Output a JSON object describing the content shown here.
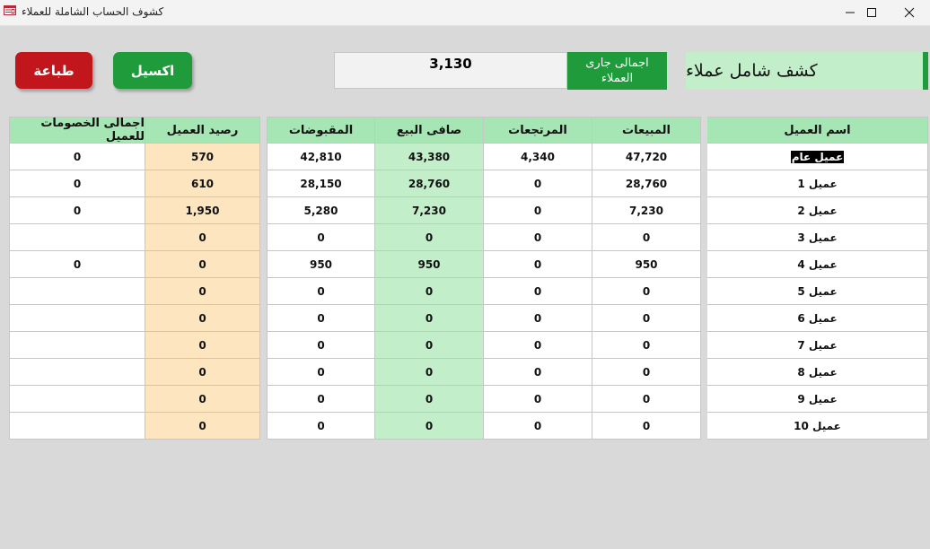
{
  "window": {
    "title": "كشوف الحساب الشاملة للعملاء",
    "app_icon": "form-icon",
    "controls": [
      "minimize-icon",
      "maximize-icon",
      "close-icon"
    ]
  },
  "header": {
    "report_title": "كشف شامل عملاء",
    "total_label": "اجمالى جارى\nالعملاء",
    "total_value": "3,130",
    "excel_button": "اكسيل",
    "print_button": "طباعة"
  },
  "colors": {
    "accent_green": "#1f9b3c",
    "header_green": "#a6e6b5",
    "light_green": "#c2efca",
    "balance_peach": "#fde5c0",
    "print_red": "#c0161c"
  },
  "customers_table": {
    "columns": [
      "اسم العميل",
      "المبيعات",
      "المرتجعات",
      "صافى البيع",
      "المقبوضات"
    ],
    "rows": [
      [
        "عميل عام",
        "47,720",
        "4,340",
        "43,380",
        "42,810"
      ],
      [
        "عميل 1",
        "28,760",
        "0",
        "28,760",
        "28,150"
      ],
      [
        "عميل 2",
        "7,230",
        "0",
        "7,230",
        "5,280"
      ],
      [
        "عميل 3",
        "0",
        "0",
        "0",
        "0"
      ],
      [
        "عميل 4",
        "950",
        "0",
        "950",
        "950"
      ],
      [
        "عميل 5",
        "0",
        "0",
        "0",
        "0"
      ],
      [
        "عميل 6",
        "0",
        "0",
        "0",
        "0"
      ],
      [
        "عميل 7",
        "0",
        "0",
        "0",
        "0"
      ],
      [
        "عميل 8",
        "0",
        "0",
        "0",
        "0"
      ],
      [
        "عميل 9",
        "0",
        "0",
        "0",
        "0"
      ],
      [
        "عميل 10",
        "0",
        "0",
        "0",
        "0"
      ]
    ],
    "selected_row": 0
  },
  "balances_table": {
    "columns": [
      "رصيد العميل",
      "اجمالى الخصومات للعميل"
    ],
    "rows": [
      [
        "570",
        "0"
      ],
      [
        "610",
        "0"
      ],
      [
        "1,950",
        "0"
      ],
      [
        "0",
        ""
      ],
      [
        "0",
        "0"
      ],
      [
        "0",
        ""
      ],
      [
        "0",
        ""
      ],
      [
        "0",
        ""
      ],
      [
        "0",
        ""
      ],
      [
        "0",
        ""
      ],
      [
        "0",
        ""
      ]
    ]
  }
}
